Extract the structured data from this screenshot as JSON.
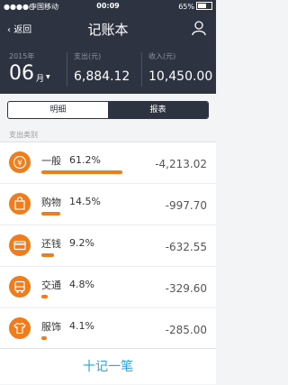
{
  "status_bar": {
    "carrier": "中国移动",
    "time": "00:09",
    "battery": "65%"
  },
  "nav": {
    "back_label": "返回",
    "title": "记账本"
  },
  "summary": {
    "year": "2015年",
    "month": "06",
    "month_unit": "月",
    "expense_label": "支出(元)",
    "expense_value": "6,884.12",
    "income_label": "收入(元)",
    "income_value": "10,450.00"
  },
  "tabs": [
    {
      "label": "明细",
      "active": false
    },
    {
      "label": "报表",
      "active": true
    }
  ],
  "section_title": "支出类别",
  "categories": [
    {
      "name": "一般",
      "percent": "61.2%",
      "amount": "-4,213.02",
      "icon": "money-icon",
      "share": 0.612
    },
    {
      "name": "购物",
      "percent": "14.5%",
      "amount": "-997.70",
      "icon": "shopping-bag-icon",
      "share": 0.145
    },
    {
      "name": "还钱",
      "percent": "9.2%",
      "amount": "-632.55",
      "icon": "credit-card-icon",
      "share": 0.092
    },
    {
      "name": "交通",
      "percent": "4.8%",
      "amount": "-329.60",
      "icon": "bus-icon",
      "share": 0.048
    },
    {
      "name": "服饰",
      "percent": "4.1%",
      "amount": "-285.00",
      "icon": "clothing-icon",
      "share": 0.041
    }
  ],
  "add_button_label": "十记一笔",
  "colors": {
    "header_bg": "#2d3340",
    "accent_orange": "#f07c1c",
    "link_blue": "#2da1e1"
  }
}
